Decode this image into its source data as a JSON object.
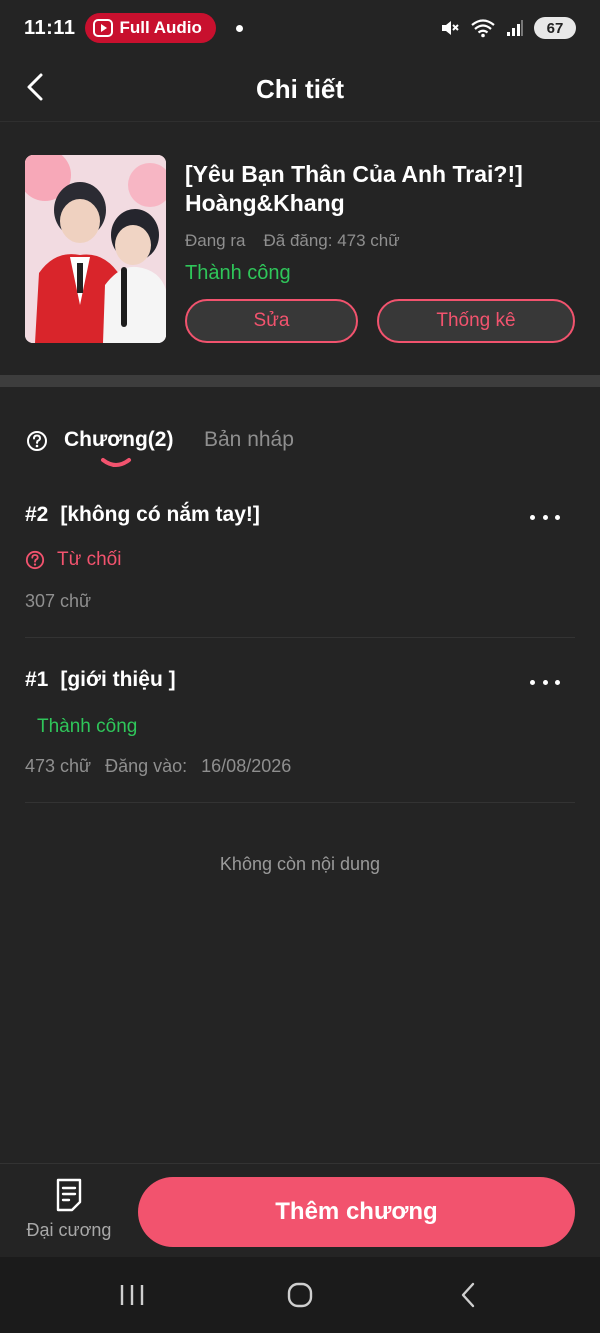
{
  "status_bar": {
    "time": "11:11",
    "pill_label": "Full Audio",
    "battery": "67",
    "icons": [
      "mute-icon",
      "wifi-icon",
      "signal-icon",
      "battery-icon"
    ]
  },
  "header": {
    "title": "Chi tiết",
    "back_icon": "chevron-left-icon"
  },
  "book": {
    "title": "[Yêu Bạn Thân Của Anh Trai?!] Hoàng&Khang",
    "status_label": "Đang ra",
    "published": "Đã đăng: 473 chữ",
    "publish_state": "Thành công",
    "edit_label": "Sửa",
    "stats_label": "Thống kê"
  },
  "tabs": {
    "help_icon": "question-circle-icon",
    "chapters_label": "Chương(2)",
    "drafts_label": "Bản nháp"
  },
  "chapters": [
    {
      "number": "#2",
      "title": "[không có nắm tay!]",
      "state": "Từ chối",
      "words": "307 chữ"
    },
    {
      "number": "#1",
      "title": "[giới thiệu ]",
      "state": "Thành công",
      "words": "473 chữ",
      "published_label": "Đăng vào:",
      "published_date": "16/08/2026"
    }
  ],
  "empty_note": "Không còn nội dung",
  "bottom": {
    "outline_label": "Đại cương",
    "add_chapter_label": "Thêm chương"
  },
  "colors": {
    "accent": "#f2536e",
    "success": "#2fc65a",
    "background": "#242424"
  }
}
